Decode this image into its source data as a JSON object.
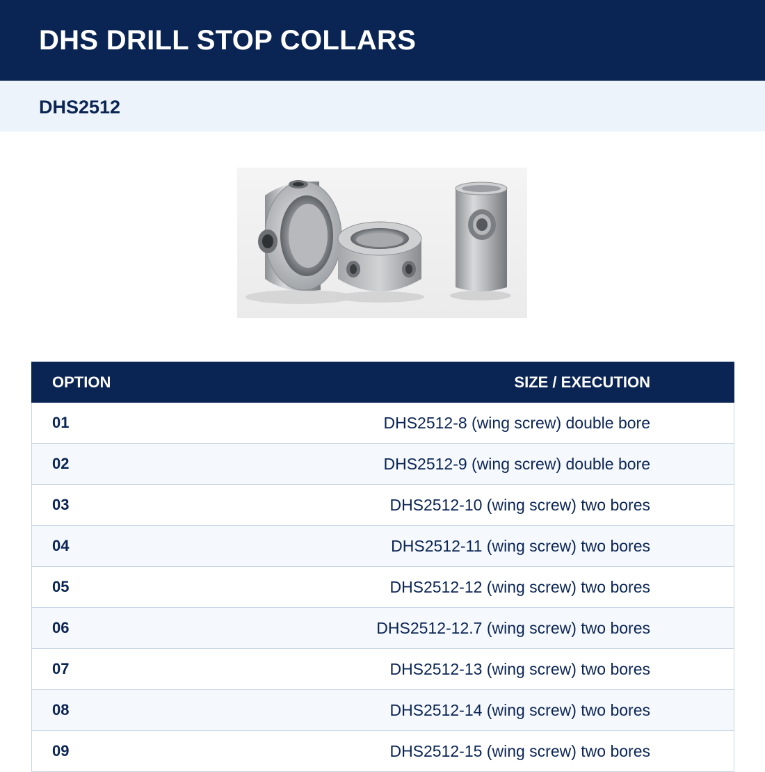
{
  "header": {
    "title": "DHS DRILL STOP COLLARS"
  },
  "subheader": {
    "product_code": "DHS2512"
  },
  "image": {
    "subject": "three stainless steel drill stop collars"
  },
  "colors": {
    "navy": "#0a2454",
    "light_band": "#edf3fa",
    "row_alt": "#f5f8fc",
    "border": "#c9d6e4"
  },
  "table": {
    "headers": {
      "option": "OPTION",
      "size": "SIZE / EXECUTION"
    },
    "rows": [
      {
        "option": "01",
        "size": "DHS2512-8 (wing screw) double bore"
      },
      {
        "option": "02",
        "size": "DHS2512-9 (wing screw) double bore"
      },
      {
        "option": "03",
        "size": "DHS2512-10 (wing screw) two bores"
      },
      {
        "option": "04",
        "size": "DHS2512-11 (wing screw) two bores"
      },
      {
        "option": "05",
        "size": "DHS2512-12 (wing screw) two bores"
      },
      {
        "option": "06",
        "size": "DHS2512-12.7 (wing screw) two bores"
      },
      {
        "option": "07",
        "size": "DHS2512-13 (wing screw) two bores"
      },
      {
        "option": "08",
        "size": "DHS2512-14 (wing screw) two bores"
      },
      {
        "option": "09",
        "size": "DHS2512-15 (wing screw) two bores"
      }
    ]
  }
}
